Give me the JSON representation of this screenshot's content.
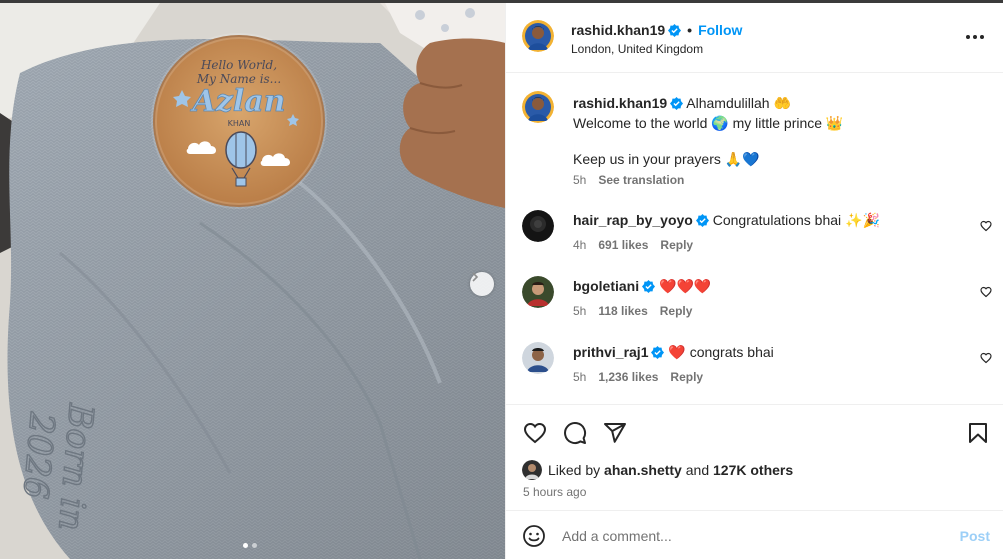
{
  "photo": {
    "plaque": {
      "line1": "Hello World,",
      "line2": "My Name is...",
      "name": "Azlan",
      "surname": "KHAN"
    },
    "embroidery": {
      "line1": "Born in",
      "line2": "2026"
    },
    "carousel": {
      "total": 2,
      "active": 1
    }
  },
  "header": {
    "username": "rashid.khan19",
    "separator": "•",
    "follow_label": "Follow",
    "location": "London, United Kingdom"
  },
  "caption": {
    "username": "rashid.khan19",
    "line1": "Alhamdulillah 🤲",
    "line2": "Welcome to the world 🌍 my little prince 👑",
    "line3": "Keep us in your prayers 🙏💙",
    "time": "5h",
    "see_translation": "See translation"
  },
  "comments": [
    {
      "username": "hair_rap_by_yoyo",
      "verified": true,
      "text": "Congratulations bhai ✨🎉",
      "time": "4h",
      "likes": "691 likes",
      "reply": "Reply"
    },
    {
      "username": "bgoletiani",
      "verified": true,
      "text": "❤️❤️❤️",
      "time": "5h",
      "likes": "118 likes",
      "reply": "Reply"
    },
    {
      "username": "prithvi_raj1",
      "verified": true,
      "text": "❤️ congrats bhai",
      "time": "5h",
      "likes": "1,236 likes",
      "reply": "Reply"
    }
  ],
  "likes": {
    "prefix": "Liked by",
    "user": "ahan.shetty",
    "and": "and",
    "others": "127K others",
    "time_ago": "5 hours ago"
  },
  "add_comment": {
    "placeholder": "Add a comment...",
    "post_label": "Post"
  },
  "colors": {
    "accent": "#0095f6",
    "verified": "#0095f6",
    "post_disabled": "#9ccff7",
    "heart": "#ed4956"
  },
  "icons": [
    "heart-icon",
    "comment-icon",
    "share-icon",
    "bookmark-icon",
    "emoji-icon",
    "more-icon",
    "chevron-right-icon",
    "verified-icon"
  ]
}
